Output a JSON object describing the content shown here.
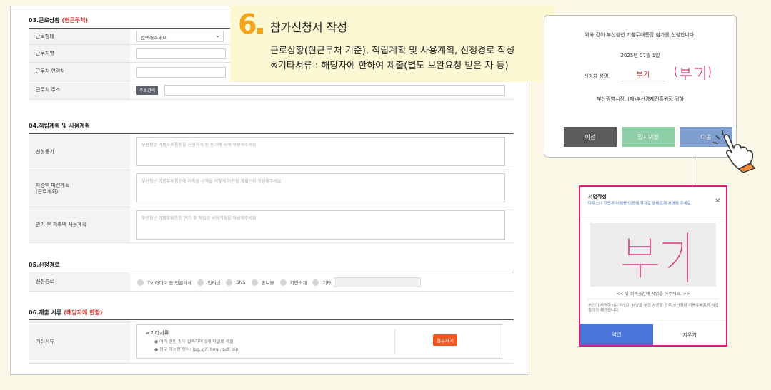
{
  "form": {
    "sec03": {
      "title": "03.근로상황",
      "note": "(현근무처)"
    },
    "sec03_rows": {
      "status_label": "근로형태",
      "status_value": "선택해주세요",
      "company_label": "근무처명",
      "contact_label": "근무처 연락처",
      "address_label": "근무처 주소",
      "address_button": "주소검색"
    },
    "sec04": {
      "title": "04.적립계획 및 사용계획"
    },
    "sec04_rows": {
      "motive_label": "신청동기",
      "motive_placeholder": "부산청년 기쁨두배통장을 신청하게 된 동기에 대해 작성해주세요",
      "plan_label_1": "자증액 마련계획",
      "plan_label_2": "(근로계획)",
      "plan_placeholder": "부산청년 기쁨두배통장에 저축할 금액을 어떻게 마련할 계획인지 작성해주세요",
      "use_label": "만기 후 저축액 사용계획",
      "use_placeholder": "부산청년 기쁨두배통장 만기 후 적립금 사용계획을 작성해주세요"
    },
    "sec05": {
      "title": "05.신청경로"
    },
    "sec05_rows": {
      "route_label": "신청경로",
      "options": [
        "TV·라디오 등 언론매체",
        "인터넷",
        "SNS",
        "홍보물",
        "지인소개",
        "기타"
      ]
    },
    "sec06": {
      "title": "06.제출 서류",
      "note": "(해당자에 한함)"
    },
    "sec06_rows": {
      "docs_label": "기타서류",
      "file_title": "기타서류",
      "note_1": "● 여러 건인 경우 압축하여 1개 파일로 제출",
      "note_2": "● 첨부 가능한 형식: jpg, gif, bmp, pdf, zip",
      "attach_button": "첨부하기"
    }
  },
  "callout": {
    "number": "6",
    "title": "참가신청서 작성",
    "line1": "근로상황(현근무처 기준), 적립계획 및 사용계획, 신청경로 작성",
    "line2": "※기타서류 : 해당자에 한하여 제출(별도 보완요청 받은 자 등)"
  },
  "confirm": {
    "statement": "위와 같이 부산청년 기쁨두배통장 참가를 신청합니다.",
    "date": "2025년 07월 1일",
    "applicant_label": "신청자 성명",
    "applicant_name": "부기",
    "recipient": "부산광역시장, (재)부산경제진흥원장 귀하",
    "prev_button": "이전",
    "save_button": "임시저장",
    "next_button": "다음"
  },
  "modal": {
    "title": "서명작성",
    "subtitle": "마우스나 핸드폰 터치를 이용해 정자로 올바르게 서명해 주세요",
    "close": "×",
    "guide": "<< 위 회색공간에 서명을 하주세요. >>",
    "note": "본인이 서명하시는 타인이 서명을 부정 사용할 경우 부산청년 기쁨두배통장 사업 참가가 제한됩니다.",
    "ok_button": "확인",
    "erase_button": "지우기"
  },
  "colors": {
    "accent_orange": "#f5a21c",
    "red": "#e0322f",
    "pink": "#e0197b",
    "blue": "#4a74d8"
  }
}
